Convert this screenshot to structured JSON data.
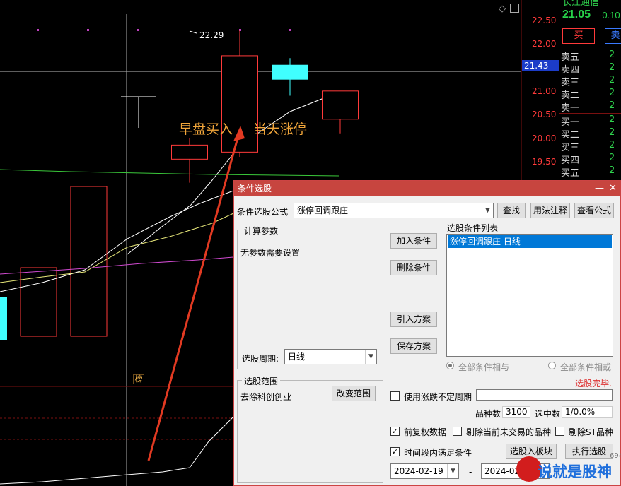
{
  "chart": {
    "price_axis": [
      "22.50",
      "22.00",
      "21.50",
      "21.00",
      "20.50",
      "20.00",
      "19.50"
    ],
    "current_price_tag": "21.43",
    "high_marker": "22.29",
    "annotation_buy": "早盘买入",
    "annotation_limit": "当天涨停",
    "bang_label": "榜",
    "colors": {
      "up": "#ff3a3a",
      "down": "#40ffff",
      "ma1": "#ffffff",
      "ma2": "#e8e87a",
      "ma3": "#d04ad0",
      "ma4": "#3ac83a",
      "arrow": "#e23a22"
    },
    "candles": [
      {
        "open": 19.55,
        "close": 19.85,
        "high": 20.0,
        "low": 19.05,
        "color": "up"
      },
      {
        "open": 19.7,
        "close": 21.75,
        "high": 22.29,
        "low": 19.6,
        "color": "up"
      },
      {
        "open": 21.55,
        "close": 21.25,
        "high": 21.7,
        "low": 20.9,
        "color": "down"
      },
      {
        "open": 20.4,
        "close": 21.0,
        "high": 21.0,
        "low": 20.1,
        "color": "up"
      }
    ]
  },
  "quote": {
    "title": "长江通信",
    "price": "21.05",
    "change": "-0.10",
    "buy_button": "买",
    "sell_button": "卖",
    "asks": [
      "卖五",
      "卖四",
      "卖三",
      "卖二",
      "卖一"
    ],
    "bids": [
      "买一",
      "买二",
      "买三",
      "买四",
      "买五"
    ],
    "value_placeholder": "2"
  },
  "dialog": {
    "title": "条件选股",
    "formula_label": "条件选股公式",
    "formula_value": "涨停回调跟庄 -",
    "btn_find": "查找",
    "btn_usage": "用法注释",
    "btn_view_formula": "查看公式",
    "calc_params_title": "计算参数",
    "no_params_text": "无参数需要设置",
    "period_label": "选股周期:",
    "period_value": "日线",
    "btn_add": "加入条件",
    "btn_delete": "删除条件",
    "btn_import": "引入方案",
    "btn_save": "保存方案",
    "list_title": "选股条件列表",
    "list_items": [
      "涨停回调跟庄  日线"
    ],
    "radio_and": "全部条件相与",
    "radio_or": "全部条件相或",
    "status": "选股完毕.",
    "scope_title": "选股范围",
    "scope_text": "去除科创创业",
    "btn_change_scope": "改变范围",
    "chk_uncertain_period": "使用涨跌不定周期",
    "stocks_label": "品种数",
    "stocks_value": "3100",
    "selected_label": "选中数",
    "selected_value": "1/0.0%",
    "chk_restore": "前复权数据",
    "chk_exclude_untraded": "剔除当前未交易的品种",
    "chk_exclude_st": "剔除ST品种",
    "chk_time_range": "时间段内满足条件",
    "btn_to_block": "选股入板块",
    "btn_execute": "执行选股",
    "date_from": "2024-02-19",
    "date_sep": "-",
    "date_to": "2024-02-"
  },
  "watermark": {
    "text": "说就是股神",
    "sub": "694.cn"
  }
}
